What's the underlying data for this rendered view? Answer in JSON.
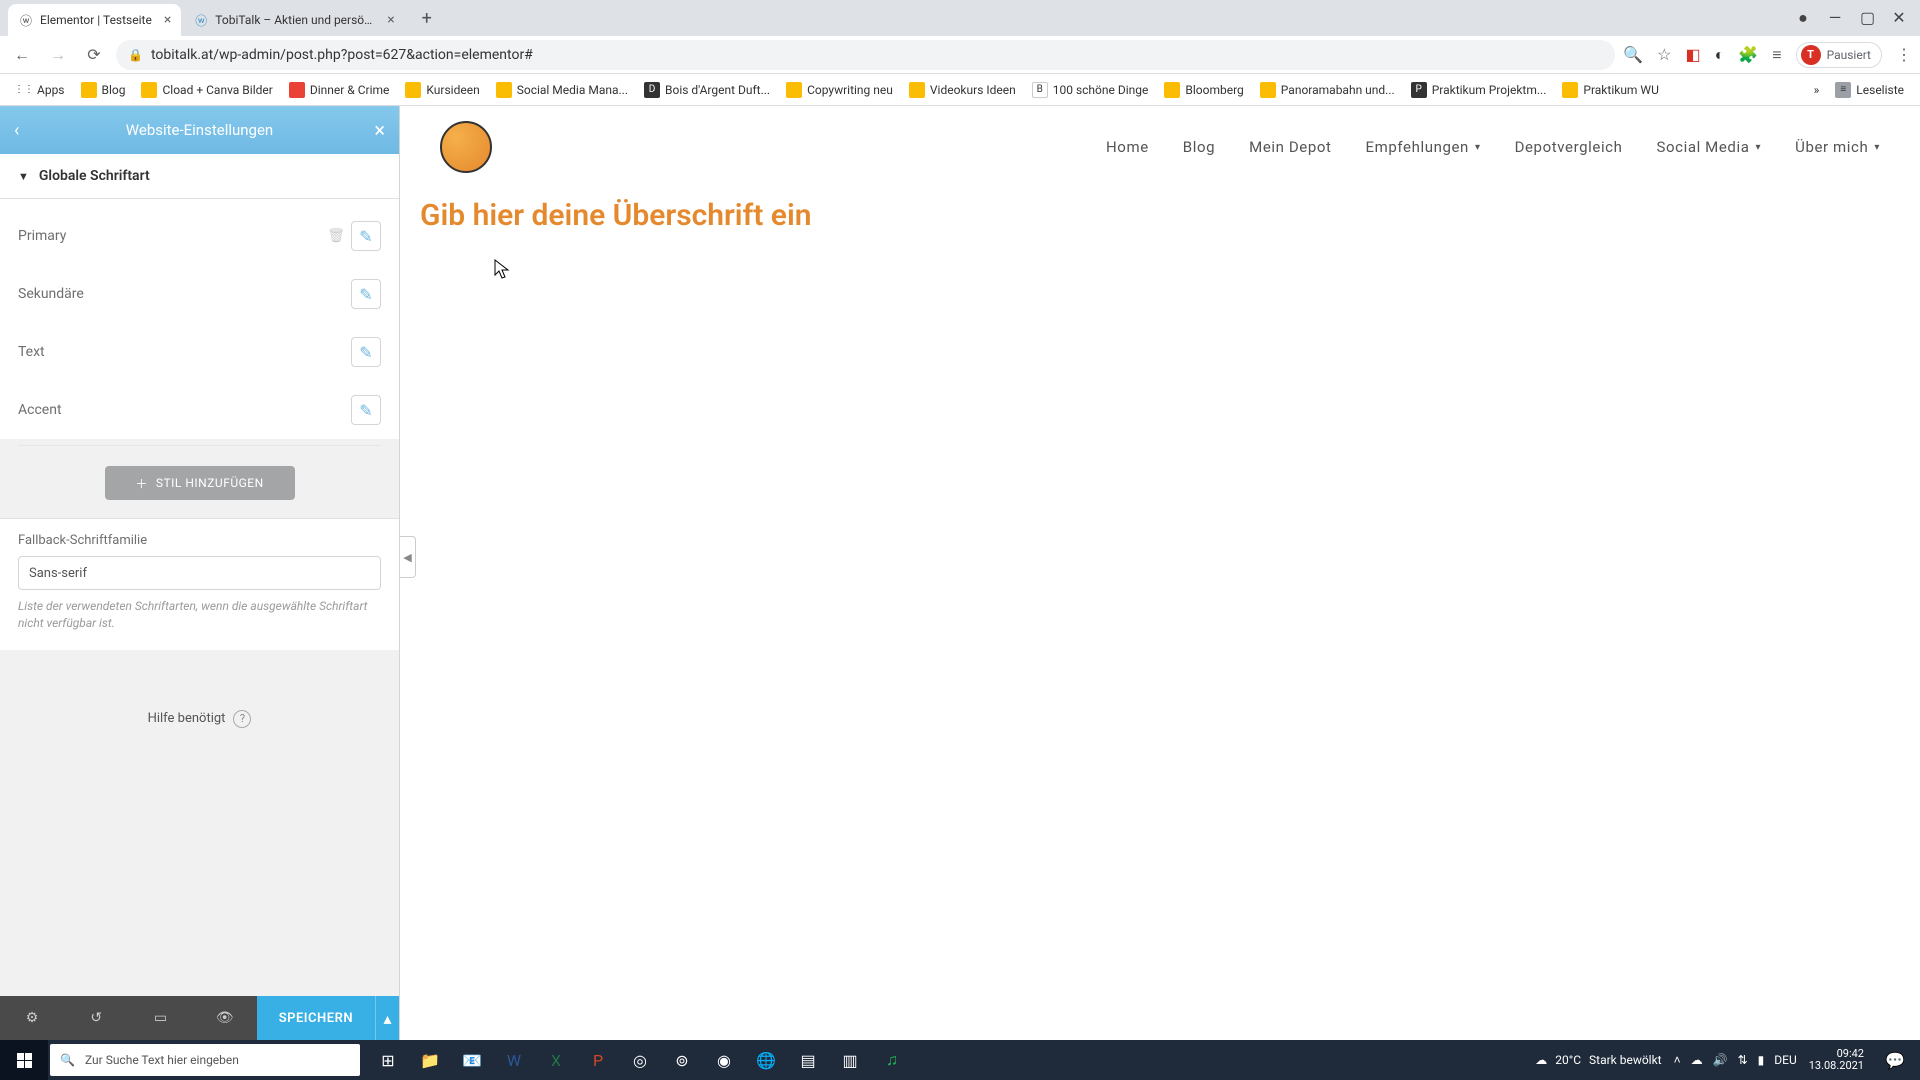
{
  "browser": {
    "tabs": [
      {
        "title": "Elementor | Testseite",
        "active": true
      },
      {
        "title": "TobiTalk – Aktien und persönliche",
        "active": false
      }
    ],
    "url": "tobitalk.at/wp-admin/post.php?post=627&action=elementor#",
    "paused_label": "Pausiert",
    "avatar_initial": "T",
    "bookmarks": [
      "Apps",
      "Blog",
      "Cload + Canva Bilder",
      "Dinner & Crime",
      "Kursideen",
      "Social Media Mana...",
      "Bois d'Argent Duft...",
      "Copywriting neu",
      "Videokurs Ideen",
      "100 schöne Dinge",
      "Bloomberg",
      "Panoramabahn und...",
      "Praktikum Projektm...",
      "Praktikum WU"
    ],
    "reading_list": "Leseliste"
  },
  "panel": {
    "title": "Website-Einstellungen",
    "section": "Globale Schriftart",
    "fonts": [
      "Primary",
      "Sekundäre",
      "Text",
      "Accent"
    ],
    "add_style": "STIL HINZUFÜGEN",
    "fallback_label": "Fallback-Schriftfamilie",
    "fallback_value": "Sans-serif",
    "fallback_help": "Liste der verwendeten Schriftarten, wenn die ausgewählte Schriftart nicht verfügbar ist.",
    "help": "Hilfe benötigt",
    "save": "SPEICHERN"
  },
  "site": {
    "nav": [
      "Home",
      "Blog",
      "Mein Depot",
      "Empfehlungen",
      "Depotvergleich",
      "Social Media",
      "Über mich"
    ],
    "nav_dropdown": {
      "Empfehlungen": true,
      "Social Media": true,
      "Über mich": true
    },
    "heading": "Gib hier deine Überschrift ein"
  },
  "taskbar": {
    "search_placeholder": "Zur Suche Text hier eingeben",
    "weather_temp": "20°C",
    "weather_desc": "Stark bewölkt",
    "lang": "DEU",
    "time": "09:42",
    "date": "13.08.2021"
  }
}
